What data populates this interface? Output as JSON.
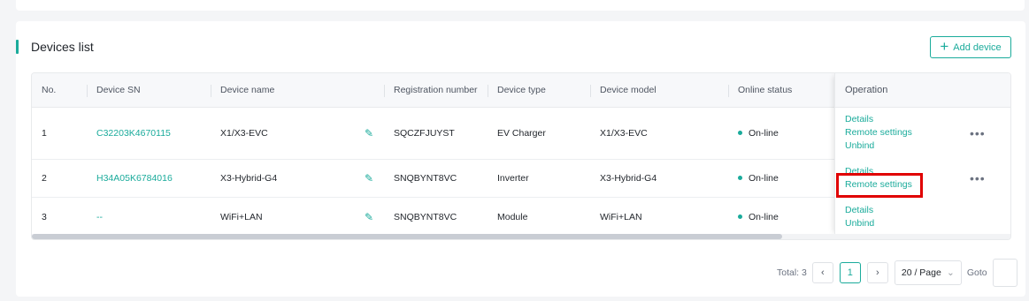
{
  "card": {
    "title": "Devices list",
    "add_button": "Add device"
  },
  "table": {
    "headers": {
      "no": "No.",
      "sn": "Device SN",
      "name": "Device name",
      "reg": "Registration number",
      "type": "Device type",
      "model": "Device model",
      "status": "Online status",
      "op": "Operation"
    },
    "rows": [
      {
        "no": "1",
        "sn": "C32203K4670115",
        "name": "X1/X3-EVC",
        "reg": "SQCZFJUYST",
        "type": "EV Charger",
        "model": "X1/X3-EVC",
        "status": "On-line",
        "ops": [
          "Details",
          "Remote settings",
          "Unbind"
        ]
      },
      {
        "no": "2",
        "sn": "H34A05K6784016",
        "name": "X3-Hybrid-G4",
        "reg": "SNQBYNT8VC",
        "type": "Inverter",
        "model": "X3-Hybrid-G4",
        "status": "On-line",
        "ops": [
          "Details",
          "Remote settings"
        ]
      },
      {
        "no": "3",
        "sn": "--",
        "name": "WiFi+LAN",
        "reg": "SNQBYNT8VC",
        "type": "Module",
        "model": "WiFi+LAN",
        "status": "On-line",
        "ops": [
          "Details",
          "Unbind"
        ]
      }
    ],
    "more_glyph": "•••"
  },
  "pagination": {
    "total": "Total: 3",
    "current_page": "1",
    "page_size": "20 / Page",
    "goto": "Goto",
    "prev": "‹",
    "next": "›",
    "chevron": "⌄"
  },
  "colors": {
    "accent": "#1aab9b",
    "highlight": "#e00000"
  }
}
